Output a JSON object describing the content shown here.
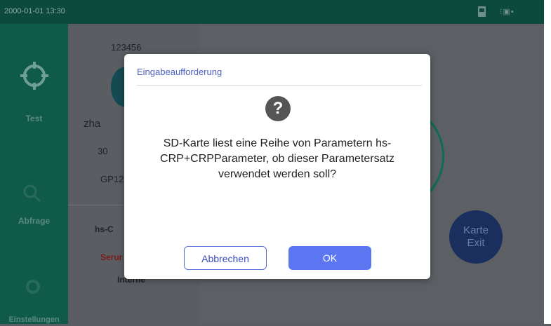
{
  "status_bar": {
    "time": "2000-01-01 13:30",
    "device_text": "⁝▣▪"
  },
  "sidebar": {
    "items": [
      {
        "label": "Test",
        "icon": "crosshair-icon"
      },
      {
        "label": "Abfrage",
        "icon": "search-icon"
      },
      {
        "label": "Einstellungen",
        "icon": "settings-icon"
      }
    ]
  },
  "panel": {
    "id_value": "123456",
    "name_partial": "zha",
    "age_value": "30",
    "code_partial": "GP12",
    "item_partial": "hs-C",
    "sample_partial": "Serur",
    "source_partial": "Interne"
  },
  "right": {
    "exit_line1": "Karte",
    "exit_line2": "Exit"
  },
  "dialog": {
    "title": "Eingabeaufforderung",
    "icon": "question-icon",
    "message": "SD-Karte liest eine Reihe von Parametern hs-CRP+CRPParameter, ob dieser Parametersatz verwendet werden soll?",
    "cancel_label": "Abbrechen",
    "ok_label": "OK"
  },
  "colors": {
    "sidebar_bg": "#0f5a48",
    "statusbar_bg": "#0d4a3e",
    "dialog_title": "#4f63c4",
    "ok_button": "#5b76f0"
  }
}
